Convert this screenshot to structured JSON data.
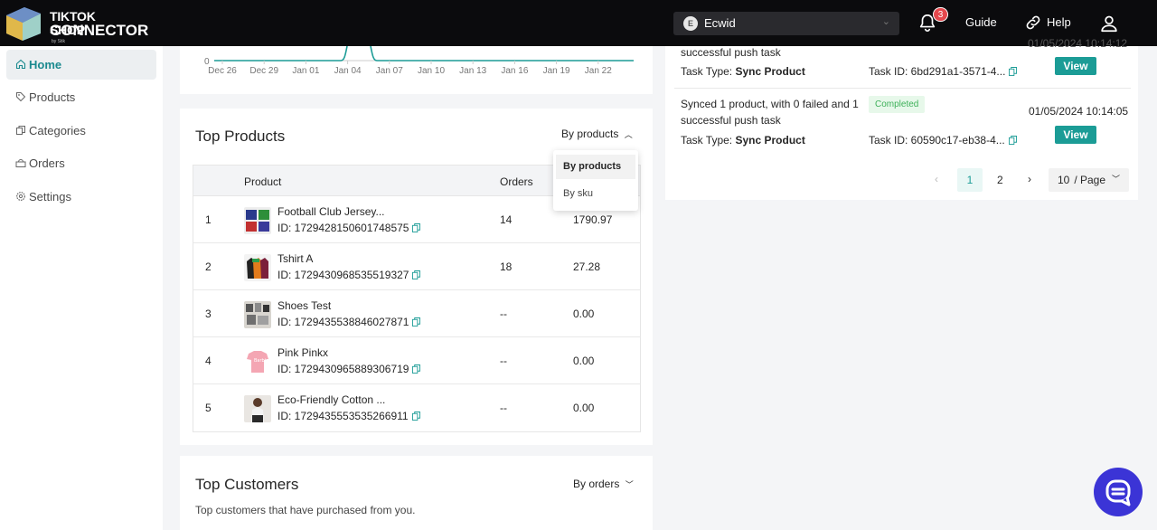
{
  "header": {
    "logo_line1": "TIKTOK SHOP",
    "logo_line2": "CONNECTOR",
    "logo_line3": "by Stik",
    "store_initial": "E",
    "store_name": "Ecwid",
    "notification_count": "3",
    "guide_label": "Guide",
    "help_label": "Help"
  },
  "sidebar": {
    "items": [
      {
        "label": "Home",
        "icon": "home-icon",
        "active": true
      },
      {
        "label": "Products",
        "icon": "tag-icon"
      },
      {
        "label": "Categories",
        "icon": "copy-icon"
      },
      {
        "label": "Orders",
        "icon": "orders-icon"
      },
      {
        "label": "Settings",
        "icon": "settings-icon"
      }
    ]
  },
  "chart": {
    "y_tick": "0",
    "x_ticks": [
      "Dec 26",
      "Dec 29",
      "Jan 01",
      "Jan 04",
      "Jan 07",
      "Jan 10",
      "Jan 13",
      "Jan 16",
      "Jan 19",
      "Jan 22"
    ],
    "line_color": "#1b9c96"
  },
  "top_products": {
    "title": "Top Products",
    "sort_label": "By products",
    "dropdown": [
      "By products",
      "By sku"
    ],
    "columns": {
      "product": "Product",
      "orders": "Orders"
    },
    "rows": [
      {
        "rank": "1",
        "name": "Football Club Jersey...",
        "id": "ID: 1729428150601748575",
        "orders": "14",
        "amount": "1790.97"
      },
      {
        "rank": "2",
        "name": "Tshirt A",
        "id": "ID: 1729430968535519327",
        "orders": "18",
        "amount": "27.28"
      },
      {
        "rank": "3",
        "name": "Shoes Test",
        "id": "ID: 1729435538846027871",
        "orders": "--",
        "amount": "0.00"
      },
      {
        "rank": "4",
        "name": "Pink Pinkx",
        "id": "ID: 1729430965889306719",
        "orders": "--",
        "amount": "0.00"
      },
      {
        "rank": "5",
        "name": "Eco-Friendly Cotton ...",
        "id": "ID: 1729435553535266911",
        "orders": "--",
        "amount": "0.00"
      }
    ]
  },
  "top_customers": {
    "title": "Top Customers",
    "sort_label": "By orders",
    "subtitle": "Top customers that have purchased from you."
  },
  "tasks": {
    "items": [
      {
        "message_tail": "successful push task",
        "task_type_label": "Task Type:",
        "task_type": "Sync Product",
        "task_id": "Task ID: 6bd291a1-3571-4...",
        "time": "01/05/2024 10:14:12",
        "view_label": "View"
      },
      {
        "message_line1": "Synced 1 product, with 0 failed and 1",
        "message_line2": "successful push task",
        "status": "Completed",
        "task_type_label": "Task Type:",
        "task_type": "Sync Product",
        "task_id": "Task ID: 60590c17-eb38-4...",
        "time": "01/05/2024 10:14:05",
        "view_label": "View"
      }
    ],
    "pagination": {
      "prev": "‹",
      "pages": [
        "1",
        "2"
      ],
      "next": "›",
      "page_size": "10",
      "page_size_suffix": " / Page"
    }
  },
  "colors": {
    "accent": "#1b9c96",
    "brand_dark": "#0b0b0d",
    "fab": "#3b34d6"
  }
}
